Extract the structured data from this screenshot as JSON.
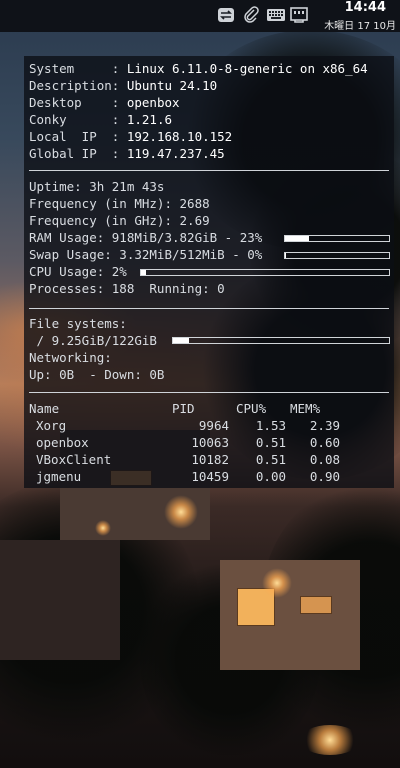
{
  "taskbar": {
    "time": "14:44",
    "date": "木曜日 17 10月",
    "tray_icons": [
      "network-toggle-icon",
      "paperclip-icon",
      "keyboard-icon",
      "ethernet-icon"
    ]
  },
  "conky": {
    "system": [
      {
        "key": "System",
        "value": "Linux 6.11.0-8-generic on x86_64"
      },
      {
        "key": "Description",
        "value": "Ubuntu 24.10"
      },
      {
        "key": "Desktop",
        "value": "openbox"
      },
      {
        "key": "Conky",
        "value": "1.21.6"
      },
      {
        "key": "Local  IP",
        "value": "192.168.10.152"
      },
      {
        "key": "Global IP",
        "value": "119.47.237.45"
      }
    ],
    "uptime": "Uptime: 3h 21m 43s",
    "freq_mhz": "Frequency (in MHz): 2688",
    "freq_ghz": "Frequency (in GHz): 2.69",
    "ram": {
      "label": "RAM Usage: 918MiB/3.82GiB - 23%",
      "percent": 23
    },
    "swap": {
      "label": "Swap Usage: 3.32MiB/512MiB - 0%",
      "percent": 0.65
    },
    "cpu": {
      "label": "CPU Usage: 2%",
      "percent": 2
    },
    "processes": "Processes: 188  Running: 0",
    "filesystems_title": "File systems:",
    "fs_root": {
      "label": " / 9.25GiB/122GiB",
      "percent": 7.6
    },
    "networking_title": "Networking:",
    "network": "Up: 0B  - Down: 0B",
    "process_table": {
      "headers": [
        "Name",
        "PID",
        "CPU%",
        "MEM%"
      ],
      "rows": [
        [
          "Xorg",
          "9964",
          "1.53",
          "2.39"
        ],
        [
          "openbox",
          "10063",
          "0.51",
          "0.60"
        ],
        [
          "VBoxClient",
          "10182",
          "0.51",
          "0.08"
        ],
        [
          "jgmenu",
          "10459",
          "0.00",
          "0.90"
        ]
      ]
    }
  }
}
